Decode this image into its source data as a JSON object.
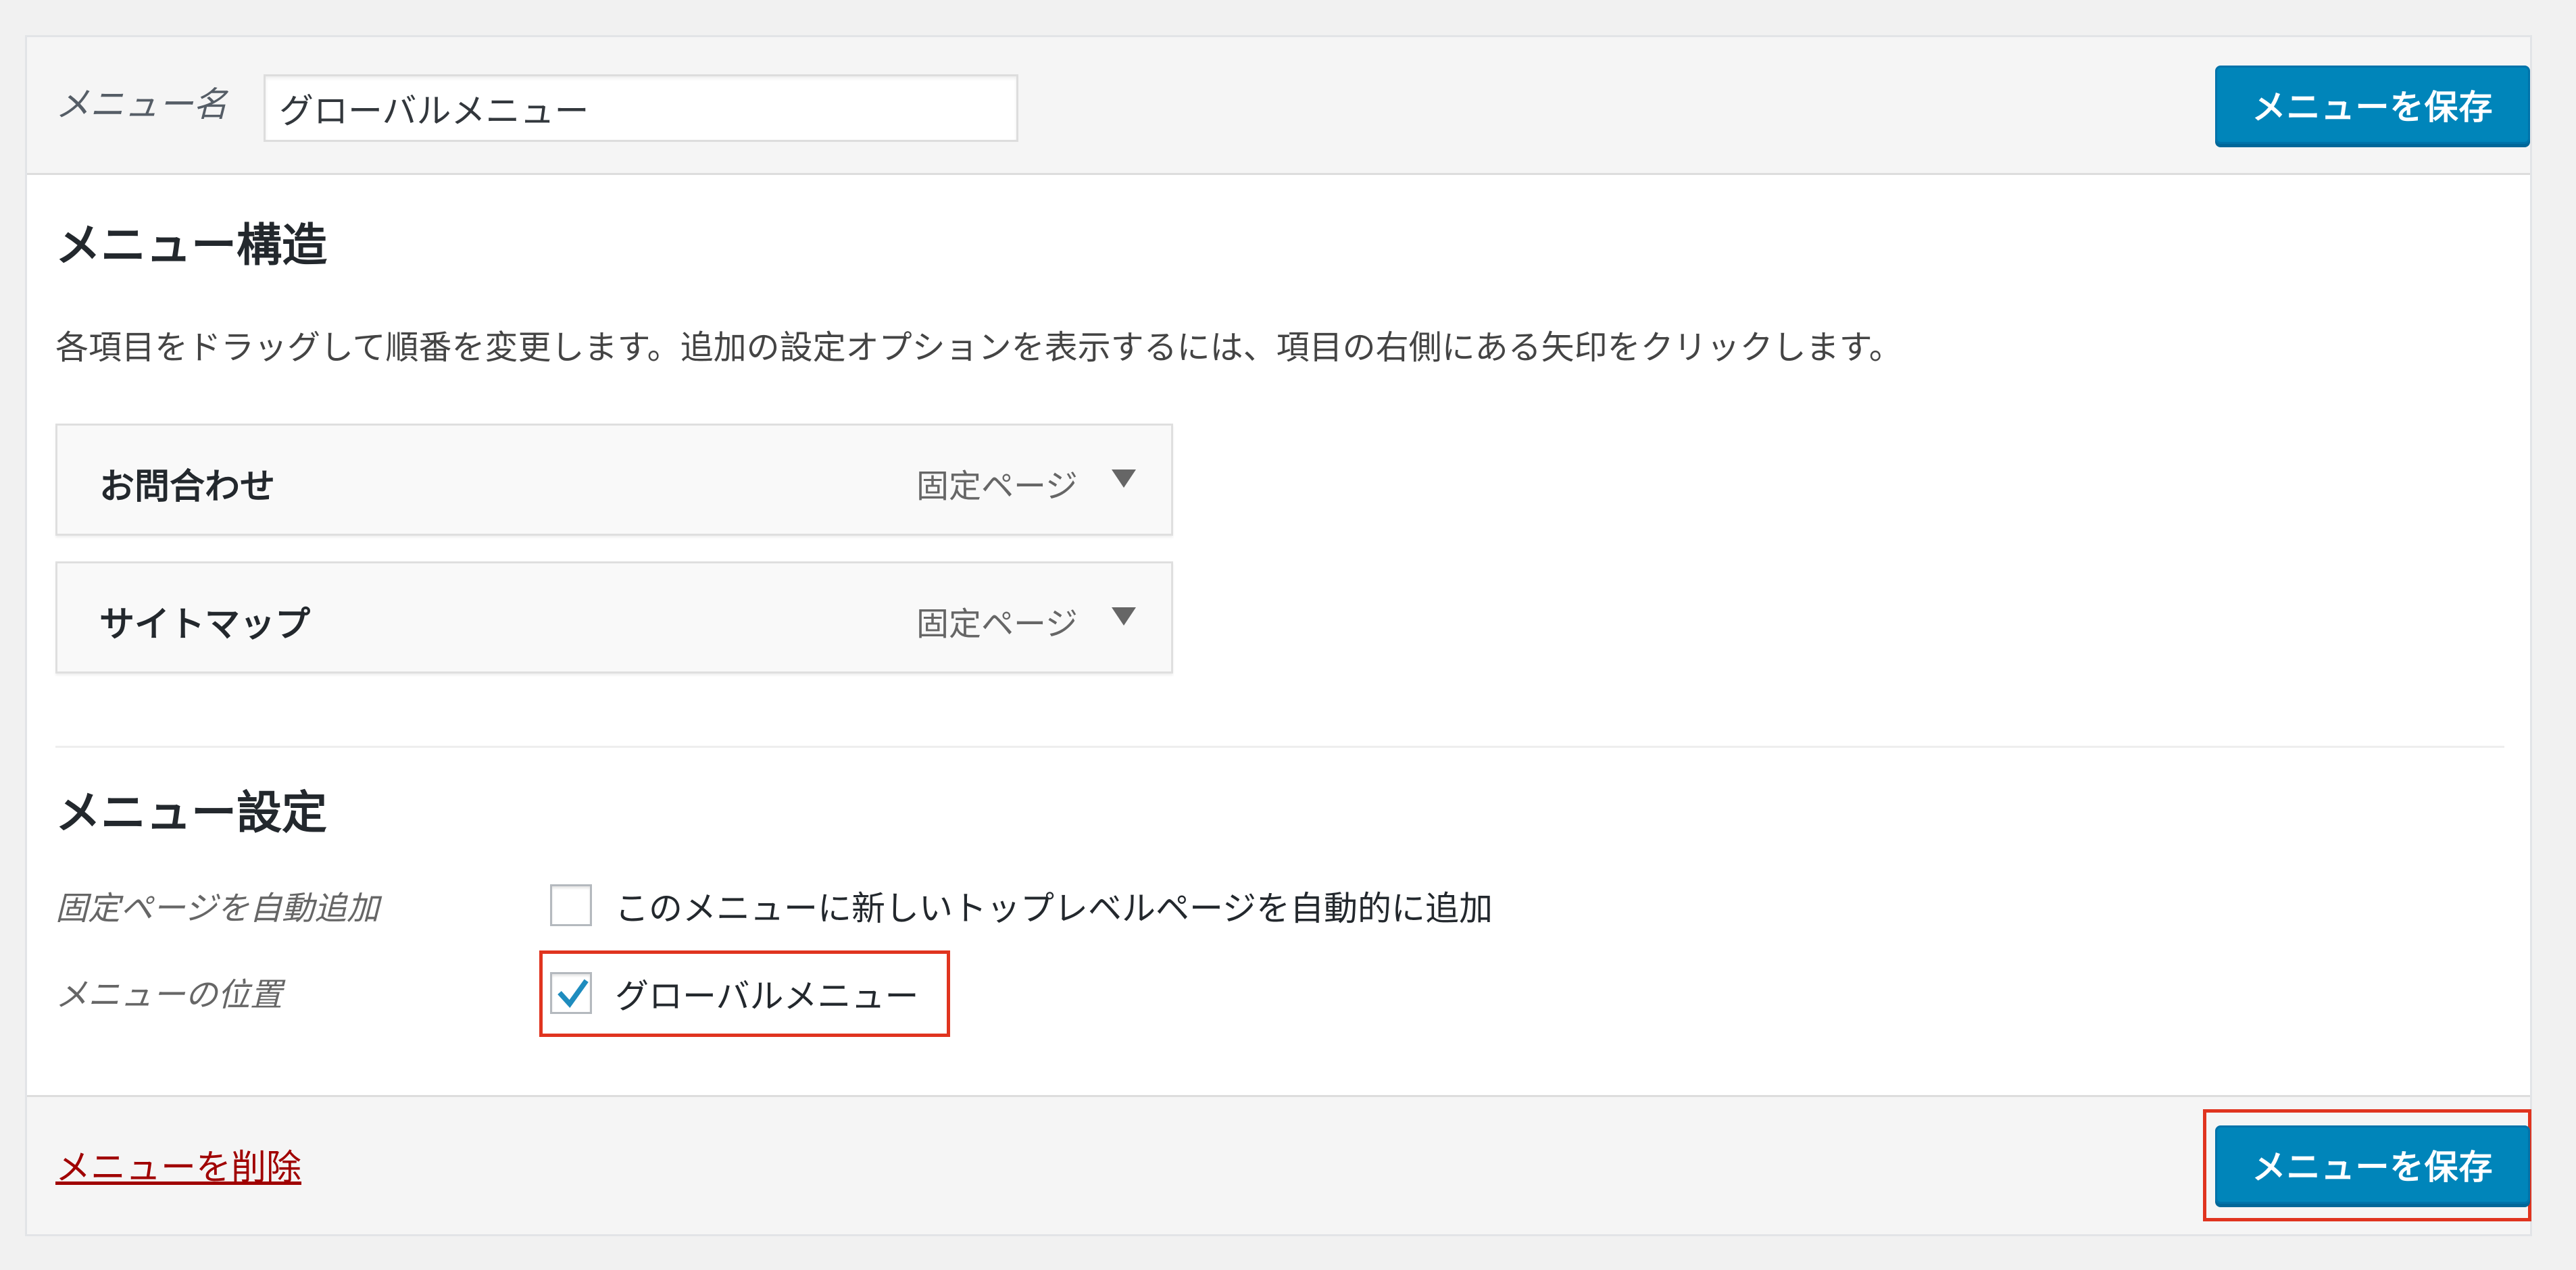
{
  "header": {
    "menu_name_label": "メニュー名",
    "menu_name_value": "グローバルメニュー",
    "save_button_label": "メニューを保存"
  },
  "structure": {
    "title": "メニュー構造",
    "description": "各項目をドラッグして順番を変更します。追加の設定オプションを表示するには、項目の右側にある矢印をクリックします。",
    "items": [
      {
        "title": "お問合わせ",
        "type": "固定ページ"
      },
      {
        "title": "サイトマップ",
        "type": "固定ページ"
      }
    ]
  },
  "settings": {
    "title": "メニュー設定",
    "auto_add_label": "固定ページを自動追加",
    "auto_add_option": "このメニューに新しいトップレベルページを自動的に追加",
    "auto_add_checked": false,
    "location_label": "メニューの位置",
    "location_option": "グローバルメニュー",
    "location_checked": true
  },
  "footer": {
    "delete_label": "メニューを削除",
    "save_button_label": "メニューを保存"
  },
  "colors": {
    "primary_button": "#0085ba",
    "delete_link": "#a00000",
    "highlight_box": "#e0341f",
    "checkmark": "#1e8cbe"
  }
}
